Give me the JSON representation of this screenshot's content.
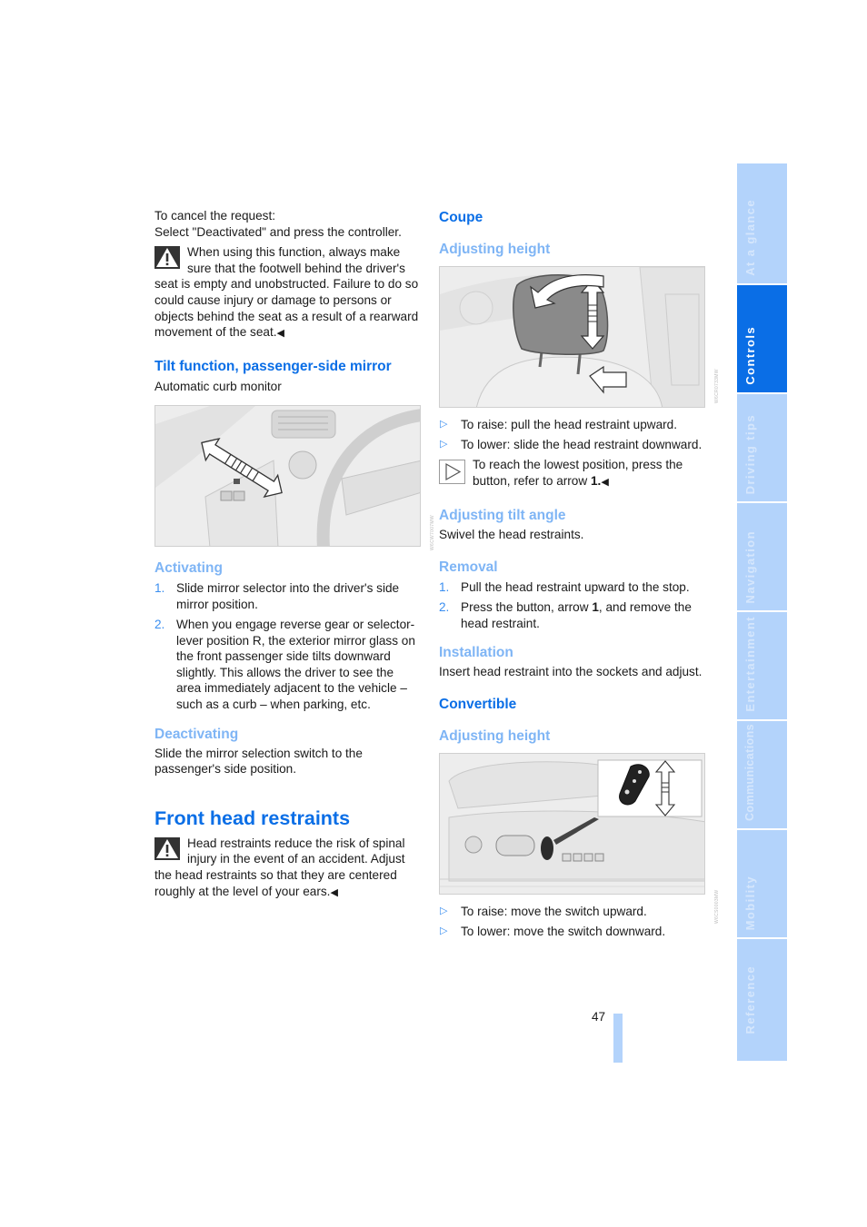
{
  "left_column": {
    "cancel_intro": "To cancel the request:",
    "cancel_instruction": "Select \"Deactivated\" and press the controller.",
    "seat_warning": "When using this function, always make sure that the footwell behind the driver's seat is empty and unobstructed. Failure to do so could cause injury or damage to persons or objects behind the seat as a result of a rearward movement of the seat.",
    "end_marker": "◀",
    "tilt_heading": "Tilt function, passenger-side mirror",
    "tilt_subtitle": "Automatic curb monitor",
    "mirror_figure_alt": "Mirror selector switch with double arrow in driver's door panel",
    "mirror_figure_code": "W6CW7007MW",
    "activating_heading": "Activating",
    "activating_steps": [
      {
        "marker": "1.",
        "text": "Slide mirror selector into the driver's side mirror position."
      },
      {
        "marker": "2.",
        "text": "When you engage reverse gear or selector-lever position R, the exterior mirror glass on the front passenger side tilts downward slightly. This allows the driver to see the area immediately adjacent to the vehicle – such as a curb – when parking, etc."
      }
    ],
    "deactivating_heading": "Deactivating",
    "deactivating_text": "Slide the mirror selection switch to the passenger's side position.",
    "front_head_heading": "Front head restraints",
    "head_warning": "Head restraints reduce the risk of spinal injury in the event of an accident. Adjust the head restraints so that they are centered roughly at the level of your ears."
  },
  "right_column": {
    "coupe_heading": "Coupe",
    "coupe_adjust_heading": "Adjusting height",
    "headrest_figure_alt": "Head restraint with height, tilt arrows and release button arrow",
    "headrest_figure_code": "W6CR0733MW",
    "coupe_bullets": [
      {
        "marker": "▷",
        "text": "To raise: pull the head restraint upward."
      },
      {
        "marker": "▷",
        "text": "To lower: slide the head restraint downward."
      }
    ],
    "lowest_note_pre": "To reach the lowest position, press the button, refer to arrow ",
    "lowest_note_bold": "1.",
    "end_marker": "◀",
    "tilt_heading": "Adjusting tilt angle",
    "tilt_text": "Swivel the head restraints.",
    "removal_heading": "Removal",
    "removal_steps": [
      {
        "marker": "1.",
        "text_pre": "Pull the head restraint upward to the stop.",
        "bold": "",
        "text_post": ""
      },
      {
        "marker": "2.",
        "text_pre": "Press the button, arrow ",
        "bold": "1",
        "text_post": ", and remove the head restraint."
      }
    ],
    "installation_heading": "Installation",
    "installation_text": "Insert head restraint into the sockets and adjust.",
    "convertible_heading": "Convertible",
    "convertible_adjust_heading": "Adjusting height",
    "seat_switch_figure_alt": "Seat side panel with head restraint switch and enlarged detail with up/down arrow",
    "seat_switch_figure_code": "W6CS0003MW",
    "convertible_bullets": [
      {
        "marker": "▷",
        "text": "To raise: move the switch upward."
      },
      {
        "marker": "▷",
        "text": "To lower: move the switch downward."
      }
    ]
  },
  "sidebar": {
    "tabs": [
      {
        "label": "At a glance",
        "active": false
      },
      {
        "label": "Controls",
        "active": true
      },
      {
        "label": "Driving tips",
        "active": false
      },
      {
        "label": "Navigation",
        "active": false
      },
      {
        "label": "Entertainment",
        "active": false
      },
      {
        "label": "Communications",
        "active": false
      },
      {
        "label": "Mobility",
        "active": false
      },
      {
        "label": "Reference",
        "active": false
      }
    ]
  },
  "footer": {
    "page_number": "47"
  },
  "colors": {
    "heading_blue": "#0a6ee6",
    "subheading_blue": "#7fb5f5",
    "tab_inactive": "#b3d3fb",
    "tab_active": "#0a6ee6"
  }
}
